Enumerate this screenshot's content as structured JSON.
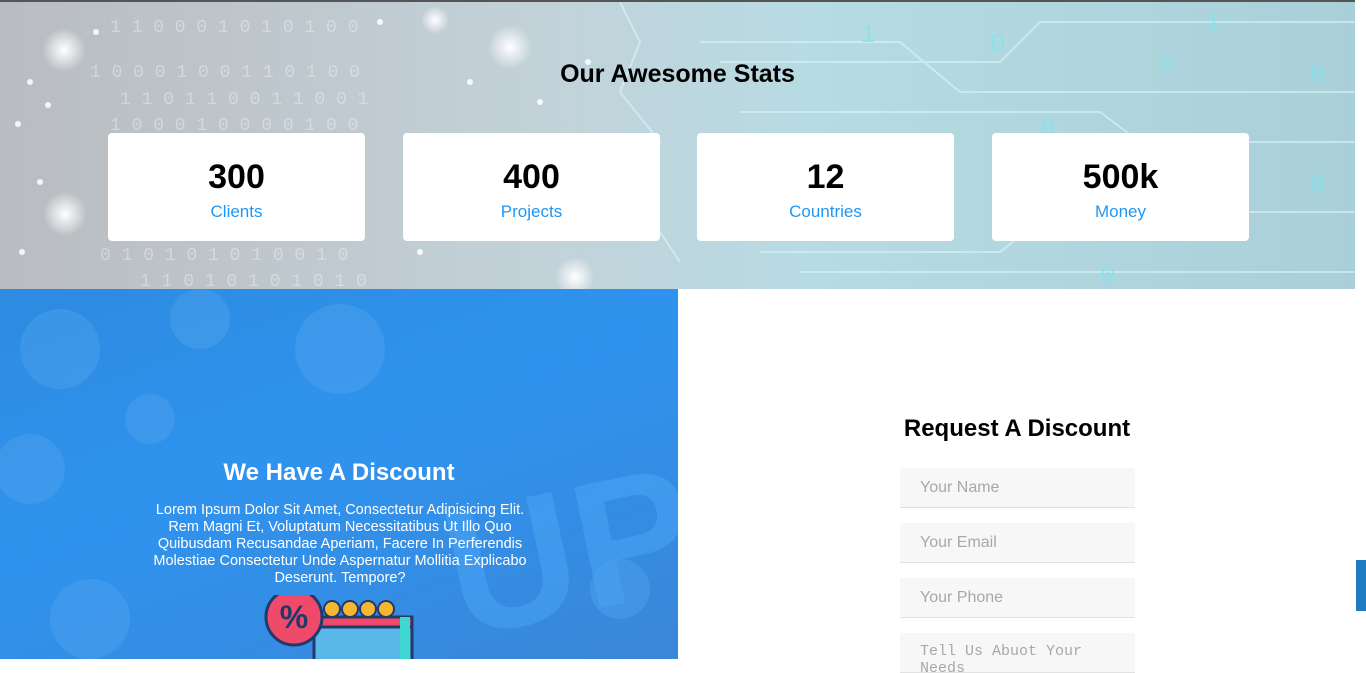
{
  "stats": {
    "title": "Our Awesome Stats",
    "items": [
      {
        "number": "300",
        "label": "Clients"
      },
      {
        "number": "400",
        "label": "Projects"
      },
      {
        "number": "12",
        "label": "Countries"
      },
      {
        "number": "500k",
        "label": "Money"
      }
    ]
  },
  "discount": {
    "title": "We Have A Discount",
    "text": "Lorem Ipsum Dolor Sit Amet, Consectetur Adipisicing Elit. Rem Magni Et, Voluptatum Necessitatibus Ut Illo Quo Quibusdam Recusandae Aperiam, Facere In Perferendis Molestiae Consectetur Unde Aspernatur Mollitia Explicabo Deserunt. Tempore?",
    "background_text": "UP T"
  },
  "form": {
    "title": "Request A Discount",
    "name_placeholder": "Your Name",
    "email_placeholder": "Your Email",
    "phone_placeholder": "Your Phone",
    "message_placeholder": "Tell Us Abuot Your Needs"
  },
  "colors": {
    "accent": "#2196f3",
    "discount_bg": "#2f93ee",
    "side_tab": "#1f7bc1"
  },
  "icons": {
    "illustration": "discount-coupon-illustration"
  }
}
